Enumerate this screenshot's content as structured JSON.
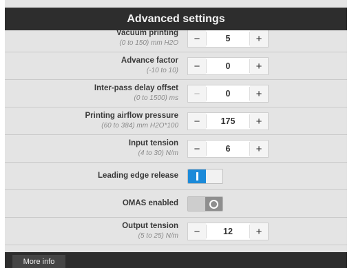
{
  "title": "Advanced settings",
  "settings": [
    {
      "label": "Vacuum printing",
      "range": "(0 to 150) mm H2O",
      "value": "5"
    },
    {
      "label": "Advance factor",
      "range": "(-10 to 10)",
      "value": "0"
    },
    {
      "label": "Inter-pass delay offset",
      "range": "(0 to 1500) ms",
      "value": "0"
    },
    {
      "label": "Printing airflow pressure",
      "range": "(60 to 384) mm H2O*100",
      "value": "175"
    },
    {
      "label": "Input tension",
      "range": "(4 to 30) N/m",
      "value": "6"
    },
    {
      "label": "Leading edge release",
      "toggle_state": "on"
    },
    {
      "label": "OMAS enabled",
      "toggle_state": "off"
    },
    {
      "label": "Output tension",
      "range": "(5 to 25) N/m",
      "value": "12"
    }
  ],
  "stepper_minus": "−",
  "stepper_plus": "+",
  "footer": {
    "more_info_label": "More info"
  },
  "colors": {
    "accent": "#1b8ad9",
    "titlebar": "#2d2d2d"
  }
}
